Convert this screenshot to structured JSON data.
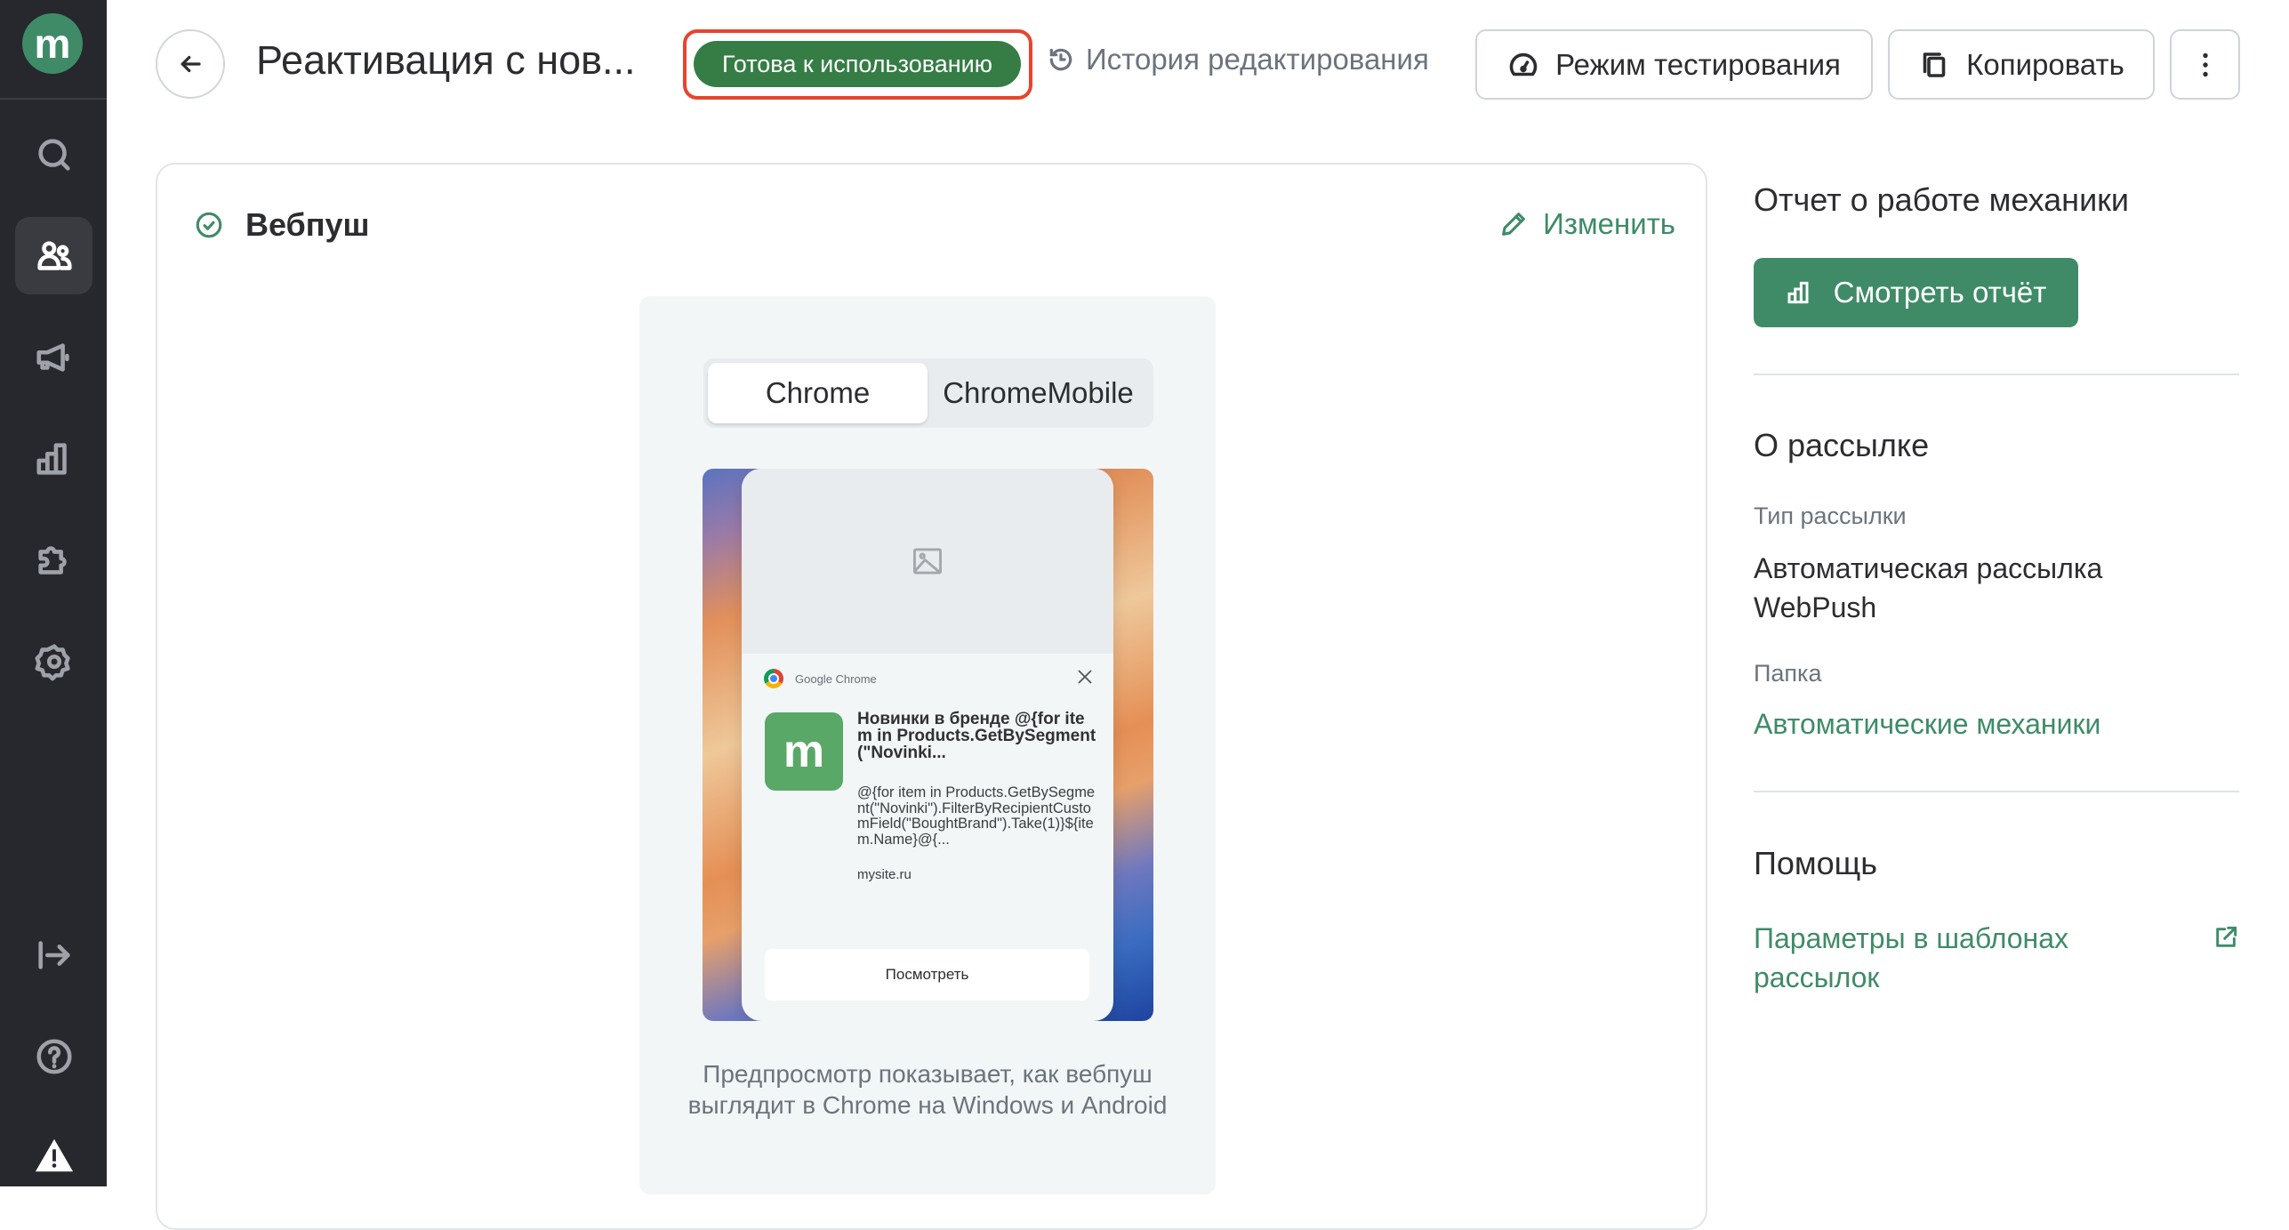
{
  "sidebar": {
    "logo": "m",
    "items": [
      {
        "name": "search",
        "icon": "search-icon"
      },
      {
        "name": "customers",
        "icon": "users-icon",
        "active": true
      },
      {
        "name": "campaigns",
        "icon": "megaphone-icon"
      },
      {
        "name": "analytics",
        "icon": "bar-chart-icon"
      },
      {
        "name": "integrations",
        "icon": "puzzle-icon"
      },
      {
        "name": "settings",
        "icon": "gear-icon"
      }
    ],
    "bottom": [
      {
        "name": "expand",
        "icon": "expand-arrow-icon"
      },
      {
        "name": "help",
        "icon": "help-circle-icon"
      },
      {
        "name": "warning",
        "icon": "warning-icon"
      }
    ]
  },
  "header": {
    "title": "Реактивация с нов...",
    "status_badge": "Готова к использованию",
    "history_link": "История редактирования",
    "test_mode_button": "Режим тестирования",
    "copy_button": "Копировать"
  },
  "webpush_card": {
    "title": "Вебпуш",
    "edit_link": "Изменить",
    "tabs": [
      {
        "label": "Chrome",
        "selected": true
      },
      {
        "label": "ChromeMobile",
        "selected": false
      }
    ],
    "notification": {
      "browser_name": "Google Chrome",
      "icon_letter": "m",
      "title": "Новинки в бренде @{for item in Products.GetBySegment(\"Novinki...",
      "body": "@{for item in Products.GetBySegment(\"Novinki\").FilterByRecipientCustomField(\"BoughtBrand\").Take(1)}${item.Name}@{...",
      "site": "mysite.ru",
      "action_button": "Посмотреть"
    },
    "caption": "Предпросмотр показывает, как вебпуш выглядит в Chrome на Windows и Android"
  },
  "right_panel": {
    "report_heading": "Отчет о работе механики",
    "report_button": "Смотреть отчёт",
    "about_heading": "О рассылке",
    "type_label": "Тип рассылки",
    "type_value": "Автоматическая рассылка WebPush",
    "folder_label": "Папка",
    "folder_value": "Автоматические механики",
    "help_heading": "Помощь",
    "help_link": "Параметры в шаблонах рассылок"
  },
  "colors": {
    "accent": "#3f8b68",
    "badge": "#357d45",
    "highlight_outline": "#e8442d",
    "sidebar_bg": "#26282d"
  }
}
